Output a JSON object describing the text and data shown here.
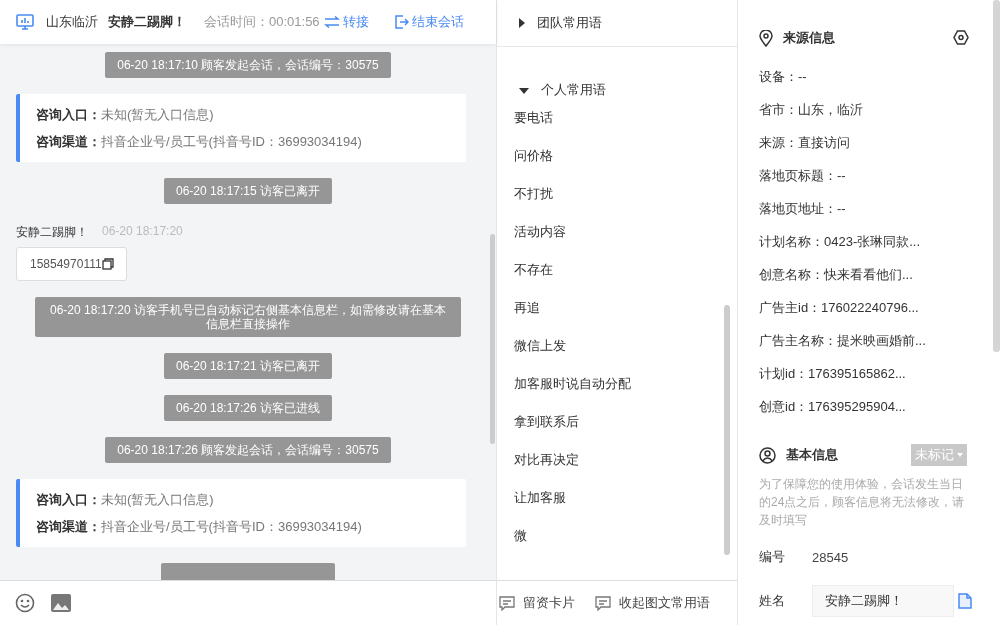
{
  "header": {
    "location": "山东临沂",
    "visitor": "安静二踢脚！",
    "duration": "会话时间：00:01:56",
    "transfer": "转接",
    "end": "结束会话"
  },
  "messages": [
    {
      "kind": "system",
      "text": "06-20 18:17:10 顾客发起会话，会话编号：30575"
    },
    {
      "kind": "entry",
      "rows": [
        {
          "label": "咨询入口：",
          "value": "未知(暂无入口信息)"
        },
        {
          "label": "咨询渠道：",
          "value": "抖音企业号/员工号(抖音号ID：36993034194)"
        }
      ]
    },
    {
      "kind": "system",
      "text": "06-20 18:17:15 访客已离开"
    },
    {
      "kind": "visitor",
      "name": "安静二踢脚！",
      "time": "06-20 18:17:20",
      "text": "15854970111"
    },
    {
      "kind": "system",
      "text": "06-20 18:17:20 访客手机号已自动标记右侧基本信息栏，如需修改请在基本信息栏直接操作"
    },
    {
      "kind": "system",
      "text": "06-20 18:17:21 访客已离开"
    },
    {
      "kind": "system",
      "text": "06-20 18:17:26 访客已进线"
    },
    {
      "kind": "system",
      "text": "06-20 18:17:26 顾客发起会话，会话编号：30575"
    },
    {
      "kind": "entry",
      "rows": [
        {
          "label": "咨询入口：",
          "value": "未知(暂无入口信息)"
        },
        {
          "label": "咨询渠道：",
          "value": "抖音企业号/员工号(抖音号ID：36993034194)"
        }
      ]
    }
  ],
  "phrase_groups": [
    {
      "title": "团队常用语",
      "expanded": false
    },
    {
      "title": "个人常用语",
      "expanded": true,
      "items": [
        "要电话",
        "问价格",
        "不打扰",
        "活动内容",
        "不存在",
        "再追",
        "微信上发",
        "加客服时说自动分配",
        "拿到联系后",
        "对比再决定",
        "让加客服",
        "微"
      ]
    }
  ],
  "bottom_actions": [
    "留资卡片",
    "收起图文常用语"
  ],
  "source_info": {
    "title": "来源信息",
    "rows": [
      "设备：--",
      "省市：山东，临沂",
      "来源：直接访问",
      "落地页标题：--",
      "落地页地址：--",
      "计划名称：0423-张琳同款...",
      "创意名称：快来看看他们...",
      "广告主id：176022240796...",
      "广告主名称：提米映画婚前...",
      "计划id：176395165862...",
      "创意id：176395295904..."
    ]
  },
  "basic_info": {
    "title": "基本信息",
    "tag": "未标记",
    "notice": "为了保障您的使用体验，会话发生当日的24点之后，顾客信息将无法修改，请及时填写",
    "fields": [
      {
        "kind": "text",
        "label": "编号",
        "value": "28545"
      },
      {
        "kind": "input",
        "label": "姓名",
        "value": "安静二踢脚！"
      }
    ]
  }
}
